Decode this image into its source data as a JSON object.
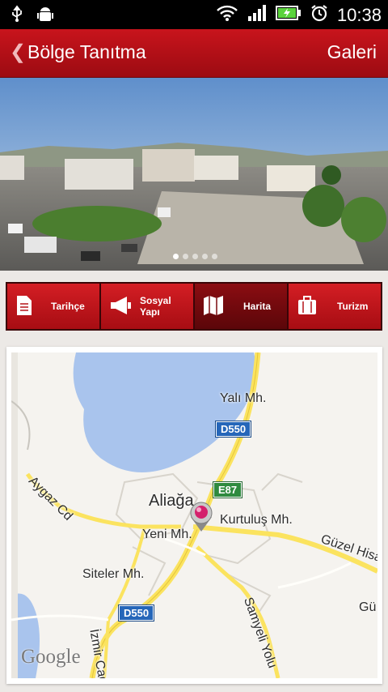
{
  "status_bar": {
    "time": "10:38",
    "icons": [
      "usb-icon",
      "android-debug-icon",
      "wifi-icon",
      "signal-icon",
      "battery-charging-icon",
      "alarm-icon"
    ]
  },
  "app_bar": {
    "title": "Bölge Tanıtma",
    "action": "Galeri"
  },
  "banner": {
    "page_count": 5,
    "active_page": 1
  },
  "tabs": [
    {
      "label": "Tarihçe",
      "icon": "document-icon"
    },
    {
      "label": "Sosyal Yapı",
      "icon": "megaphone-icon"
    },
    {
      "label": "Harita",
      "icon": "map-icon",
      "active": true
    },
    {
      "label": "Turizm",
      "icon": "luggage-icon"
    }
  ],
  "map": {
    "places": [
      "Yalı Mh.",
      "Aliağa",
      "Kurtuluş Mh.",
      "Yeni Mh.",
      "Siteler Mh.",
      "Güzel Hisar",
      "Gü",
      "Aygaz Cd",
      "Samyeli Yolu",
      "İzmir Cad."
    ],
    "roads": [
      "D550",
      "E87",
      "D550"
    ],
    "attribution": "Google",
    "colors": {
      "water": "#a9c4ed",
      "road": "#fbe35f",
      "background": "#f5f3ef"
    }
  }
}
